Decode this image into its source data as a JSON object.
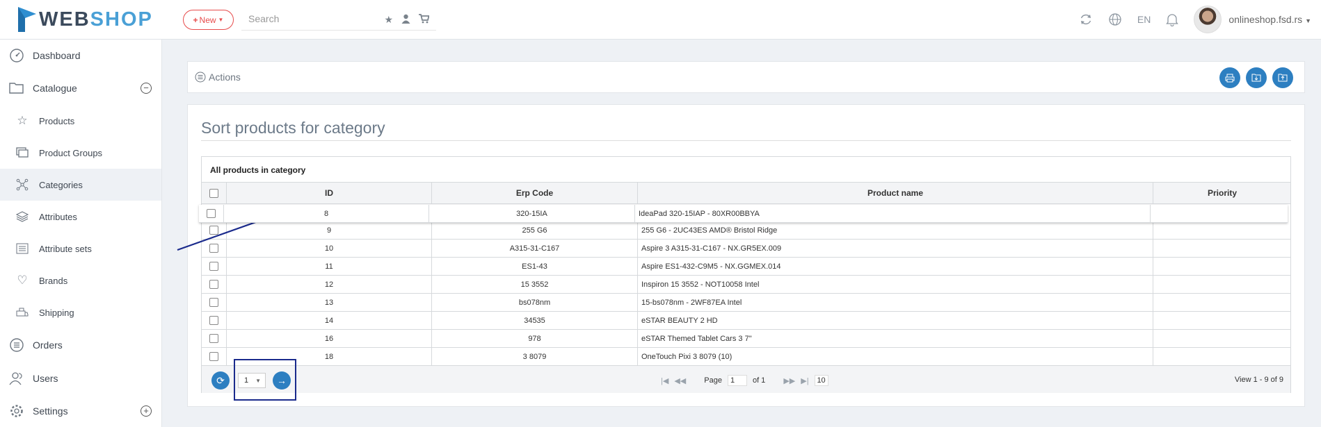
{
  "header": {
    "logo_web": "WEB",
    "logo_shop": "SHOP",
    "new_label": "New",
    "search_placeholder": "Search",
    "language": "EN",
    "user": "onlineshop.fsd.rs",
    "icons": [
      "star-icon",
      "user-icon",
      "cart-icon",
      "refresh-icon",
      "globe-icon",
      "bell-icon"
    ]
  },
  "sidebar": {
    "items": [
      {
        "label": "Dashboard",
        "icon": "dashboard-icon"
      },
      {
        "label": "Catalogue",
        "icon": "folder-icon",
        "toggle": "−"
      },
      {
        "label": "Products",
        "icon": "star-icon"
      },
      {
        "label": "Product Groups",
        "icon": "layers-icon"
      },
      {
        "label": "Categories",
        "icon": "network-icon"
      },
      {
        "label": "Attributes",
        "icon": "stack-icon"
      },
      {
        "label": "Attribute sets",
        "icon": "list-icon"
      },
      {
        "label": "Brands",
        "icon": "heart-icon"
      },
      {
        "label": "Shipping",
        "icon": "shipping-icon"
      },
      {
        "label": "Orders",
        "icon": "orders-icon"
      },
      {
        "label": "Users",
        "icon": "users-icon"
      },
      {
        "label": "Settings",
        "icon": "gear-icon",
        "toggle": "+"
      }
    ]
  },
  "actions": {
    "label": "Actions",
    "buttons": [
      "print-icon",
      "import-icon",
      "export-icon"
    ]
  },
  "main": {
    "title": "Sort products for category",
    "grid": {
      "caption": "All products in category",
      "columns": [
        "ID",
        "Erp Code",
        "Product name",
        "Priority"
      ],
      "rows": [
        {
          "id": "8",
          "erp": "320-15IA",
          "name": "IdeaPad 320-15IAP - 80XR00BBYA",
          "priority": ""
        },
        {
          "id": "9",
          "erp": "255 G6",
          "name": "255 G6 - 2UC43ES AMD® Bristol Ridge",
          "priority": ""
        },
        {
          "id": "10",
          "erp": "A315-31-C167",
          "name": "Aspire 3 A315-31-C167 - NX.GR5EX.009",
          "priority": ""
        },
        {
          "id": "11",
          "erp": "ES1-43",
          "name": "Aspire ES1-432-C9M5 - NX.GGMEX.014",
          "priority": ""
        },
        {
          "id": "12",
          "erp": "15 3552",
          "name": "Inspiron 15 3552 - NOT10058 Intel",
          "priority": ""
        },
        {
          "id": "13",
          "erp": "bs078nm",
          "name": "15-bs078nm - 2WF87EA Intel",
          "priority": ""
        },
        {
          "id": "14",
          "erp": "34535",
          "name": "eSTAR BEAUTY 2 HD",
          "priority": ""
        },
        {
          "id": "16",
          "erp": "978",
          "name": "eSTAR Themed Tablet Cars 3 7\"",
          "priority": ""
        },
        {
          "id": "18",
          "erp": "3 8079",
          "name": "OneTouch Pixi 3 8079 (10)",
          "priority": ""
        }
      ]
    },
    "pager": {
      "page_select_value": "1",
      "page_label": "Page",
      "page_value": "1",
      "of_label": "of 1",
      "rows_per_page": "10",
      "view_text": "View 1 - 9 of 9"
    }
  }
}
